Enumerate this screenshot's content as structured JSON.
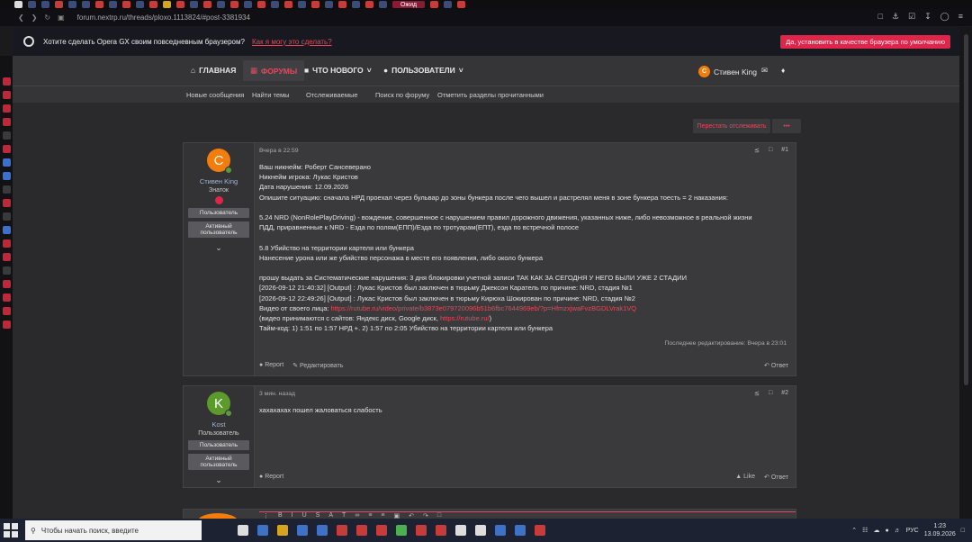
{
  "browser": {
    "url": "forum.nextrp.ru/threads/ploxo.1113824/#post-3381934",
    "active_tab": "Ожид"
  },
  "infobar": {
    "message": "Хотите сделать Opera GX своим повседневным браузером?",
    "link": "Как я могу это сделать?",
    "cta": "Да, установить в качестве браузера по умолчанию"
  },
  "nav": {
    "home": "ГЛАВНАЯ",
    "forums": "ФОРУМЫ",
    "whats_new": "ЧТО НОВОГО",
    "users": "ПОЛЬЗОВАТЕЛИ",
    "user": "Стивен King",
    "user_initial": "C"
  },
  "subnav": [
    "Новые сообщения",
    "Найти темы",
    "Отслеживаемые",
    "Поиск по форуму",
    "Отметить разделы прочитанными"
  ],
  "thread": {
    "unwatch": "Перестать отслеживать",
    "more": "•••"
  },
  "posts": [
    {
      "initial": "C",
      "avatar_color": "#f27d0c",
      "author": "Стивен King",
      "title": "Знаток",
      "roles": [
        "Пользователь",
        "Активный пользователь"
      ],
      "time": "Вчера в 22:59",
      "number": "#1",
      "lines": [
        "Ваш никнейм: Роберт Сансеверано",
        "Никнейм игрока: Лукас Кристов",
        "Дата нарушения: 12.09.2026",
        "Опишите ситуацию: сначала НРД проехал через бульвар до зоны бункера после чего вышел и растрелял меня в зоне бункера тоесть = 2 наказания:",
        "",
        "5.24 NRD (NonRolePlayDriving) - вождение, совершенное с нарушением правил дорожного движения, указанных ниже, либо невозможное в реальной жизни",
        "ПДД, приравненные к NRD - Езда по полям(ЕПП)/Езда по тротуарам(ЕПТ), езда по встречной полосе",
        "",
        "5.8 Убийство на территории картеля или бункера",
        "Нанесение урона или же убийство персонажа в месте его появления, либо около бункера",
        "",
        "прошу выдать за Систематические нарушения: 3 дня блокировки учетной записи ТАК КАК ЗА СЕГОДНЯ У НЕГО БЫЛИ УЖЕ 2 СТАДИИ",
        "[2026-09-12 21:40:32] [Output] : Лукас Кристов был заключен в тюрьму Джексон Каратель по причине: NRD, стадия №1",
        "[2026-09-12 22:49:26] [Output] : Лукас Кристов был заключен в тюрьму Кирюха Шокирован по причине: NRD, стадия №2"
      ],
      "video_prefix": "Видео от своего лица: ",
      "video_link": "https://rutube.ru/video/private/b3873e079720096b51b6fbc7644969eb/?p=HfmzxjwaFvzBGDLVrak1VQ",
      "sites_prefix": "(видео принимаются с сайтов: Яндекс диск, Google диск, ",
      "sites_link": "https://rutube.ru/",
      "sites_suffix": ")",
      "timecode": "Тайм-код: 1) 1:51 по 1:57 НРД +. 2) 1:57 по 2:05 Убийство на территории картеля или бункера",
      "edited": "Последнее редактирование: Вчера в 23:01",
      "report": "Report",
      "edit": "Редактировать",
      "reply": "Ответ"
    },
    {
      "initial": "K",
      "avatar_color": "#5c9a2c",
      "author": "Kost",
      "title": "Пользователь",
      "roles": [
        "Пользователь",
        "Активный пользователь"
      ],
      "time": "3 мин. назад",
      "number": "#2",
      "text": "хахахахах пошел жаловаться слабость",
      "report": "Report",
      "like": "Like",
      "reply": "Ответ"
    }
  ],
  "taskbar": {
    "search_placeholder": "Чтобы начать поиск, введите",
    "lang": "РУС",
    "time": "1:23",
    "date": "13.09.2026"
  }
}
